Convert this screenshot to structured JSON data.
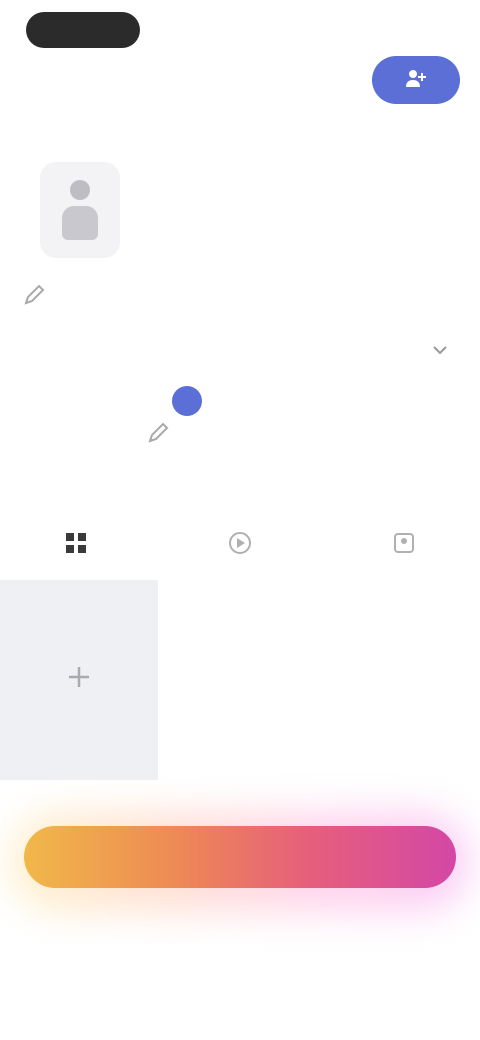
{
  "colors": {
    "accent": "#5b6fd6",
    "cta_start": "#f0b84a",
    "cta_end": "#d447a6",
    "tile_bg": "#eef0f3"
  },
  "header": {
    "follow_icon": "person-plus-icon"
  },
  "profile": {
    "avatar_icon": "person-avatar-icon",
    "edit_icon": "pencil-icon"
  },
  "tabs": {
    "more_icon": "chevron-down-icon"
  },
  "subrow": {
    "icon": "pencil-icon"
  },
  "filters": [
    {
      "icon": "grid-icon"
    },
    {
      "icon": "play-icon"
    },
    {
      "icon": "tag-icon"
    }
  ],
  "grid": {
    "tile_icon": "plus-icon"
  },
  "cta": {}
}
